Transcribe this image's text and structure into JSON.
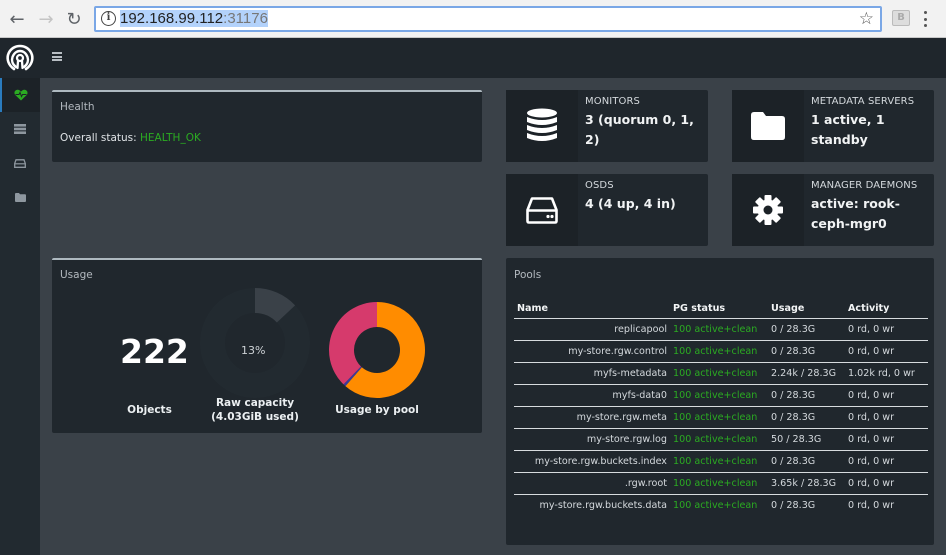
{
  "browser": {
    "url_host": "192.168.99.112",
    "url_port": ":31176",
    "ext_label": "B"
  },
  "colors": {
    "ok_green": "#2bab22",
    "pool_orange": "#ff8c00",
    "pool_pink": "#d63a6c",
    "pool_navy": "#3a3a9a",
    "accent_blue": "#2a7bbd"
  },
  "sidebar": {
    "items": [
      {
        "icon": "heartbeat-icon",
        "active": true
      },
      {
        "icon": "server-icon",
        "active": false
      },
      {
        "icon": "hdd-icon",
        "active": false
      },
      {
        "icon": "folder-icon",
        "active": false
      }
    ]
  },
  "health": {
    "title": "Health",
    "status_label": "Overall status: ",
    "status_value": "HEALTH_OK"
  },
  "stats": {
    "monitors": {
      "label": "MONITORS",
      "value": "3 (quorum 0, 1, 2)",
      "icon": "database-icon"
    },
    "metadata": {
      "label": "METADATA SERVERS",
      "value": "1 active, 1 standby",
      "icon": "folder-icon"
    },
    "osds": {
      "label": "OSDS",
      "value": "4 (4 up, 4 in)",
      "icon": "hdd-icon"
    },
    "managers": {
      "label": "MANAGER DAEMONS",
      "value": "active: rook-ceph-mgr0",
      "icon": "gear-icon"
    }
  },
  "usage": {
    "title": "Usage",
    "objects_value": "222",
    "objects_label": "Objects",
    "raw_capacity_pct": "13%",
    "raw_capacity_fraction": 0.13,
    "raw_capacity_label": "Raw capacity",
    "raw_capacity_used": "(4.03GiB used)",
    "pool_usage_label": "Usage by pool",
    "pool_slices": [
      {
        "name": ".rgw.root",
        "value": 3650,
        "color": "#ff8c00"
      },
      {
        "name": "my-store.rgw.log",
        "value": 50,
        "color": "#3a3a9a"
      },
      {
        "name": "myfs-metadata",
        "value": 2240,
        "color": "#d63a6c"
      }
    ]
  },
  "pools": {
    "title": "Pools",
    "columns": [
      "Name",
      "PG status",
      "Usage",
      "Activity"
    ],
    "rows": [
      {
        "name": "replicapool",
        "pg": "100 active+clean",
        "usage": "0 / 28.3G",
        "activity": "0 rd, 0 wr"
      },
      {
        "name": "my-store.rgw.control",
        "pg": "100 active+clean",
        "usage": "0 / 28.3G",
        "activity": "0 rd, 0 wr"
      },
      {
        "name": "myfs-metadata",
        "pg": "100 active+clean",
        "usage": "2.24k / 28.3G",
        "activity": "1.02k rd, 0 wr"
      },
      {
        "name": "myfs-data0",
        "pg": "100 active+clean",
        "usage": "0 / 28.3G",
        "activity": "0 rd, 0 wr"
      },
      {
        "name": "my-store.rgw.meta",
        "pg": "100 active+clean",
        "usage": "0 / 28.3G",
        "activity": "0 rd, 0 wr"
      },
      {
        "name": "my-store.rgw.log",
        "pg": "100 active+clean",
        "usage": "50 / 28.3G",
        "activity": "0 rd, 0 wr"
      },
      {
        "name": "my-store.rgw.buckets.index",
        "pg": "100 active+clean",
        "usage": "0 / 28.3G",
        "activity": "0 rd, 0 wr"
      },
      {
        "name": ".rgw.root",
        "pg": "100 active+clean",
        "usage": "3.65k / 28.3G",
        "activity": "0 rd, 0 wr"
      },
      {
        "name": "my-store.rgw.buckets.data",
        "pg": "100 active+clean",
        "usage": "0 / 28.3G",
        "activity": "0 rd, 0 wr"
      }
    ]
  }
}
